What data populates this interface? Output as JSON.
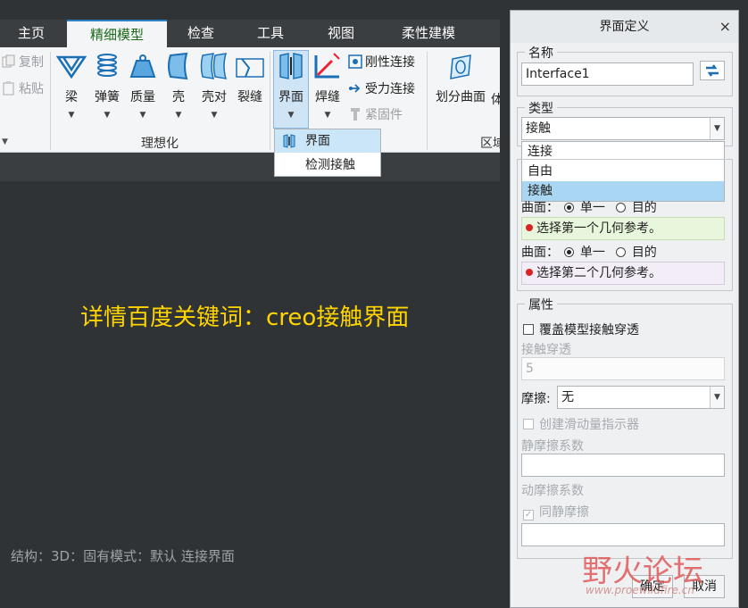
{
  "ribbon": {
    "tabs": [
      "主页",
      "精细模型",
      "检查",
      "工具",
      "视图",
      "柔性建模"
    ],
    "clipboard": {
      "copy": "复制",
      "paste": "粘贴"
    },
    "ideal": {
      "beam": "梁",
      "spring": "弹簧",
      "mass": "质量",
      "shell": "壳",
      "shell_pair": "壳对",
      "crack": "裂缝",
      "group_label": "理想化"
    },
    "connections": {
      "interface": "界面",
      "weld": "焊缝",
      "rigid_link": "刚性连接",
      "force_link": "受力连接",
      "fastener": "紧固件"
    },
    "region": {
      "split_surface": "划分曲面",
      "cut": "体",
      "group_label": "区域"
    },
    "interface_menu": [
      "界面",
      "检测接触"
    ]
  },
  "overlay_text": "详情百度关键词：creo接触界面",
  "status_bar": "结构：3D：固有模式：默认 连接界面",
  "dialog": {
    "title": "界面定义",
    "close": "×",
    "name_label": "名称",
    "name_value": "Interface1",
    "type_label": "类型",
    "type_value": "接触",
    "type_options": [
      "连接",
      "自由",
      "接触"
    ],
    "surface_label": "曲面：",
    "single": "单一",
    "target": "目的",
    "ref1": "选择第一个几何参考。",
    "ref2": "选择第二个几何参考。",
    "props_label": "属性",
    "override": "覆盖模型接触穿透",
    "penetration_label": "接触穿透",
    "penetration_value": "5",
    "friction_label": "摩擦:",
    "friction_value": "无",
    "slip_indicator": "创建滑动量指示器",
    "static_coef": "静摩擦系数",
    "dynamic_coef": "动摩擦系数",
    "same_static": "同静摩擦",
    "ok": "确定",
    "cancel": "取消"
  },
  "watermark": {
    "brand": "野火论坛",
    "url": "www.proewildfire.cn"
  }
}
